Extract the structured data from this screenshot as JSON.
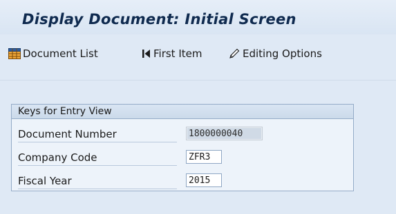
{
  "window": {
    "title": "Display Document: Initial Screen"
  },
  "toolbar": {
    "document_list": {
      "label": "Document List",
      "icon": "table-grid-icon"
    },
    "first_item": {
      "label": "First Item",
      "icon": "first-item-icon"
    },
    "editing_options": {
      "label": "Editing Options",
      "icon": "pencil-icon"
    }
  },
  "keys_group": {
    "title": "Keys for Entry View",
    "fields": [
      {
        "label": "Document Number",
        "value": "1800000040"
      },
      {
        "label": "Company Code",
        "value": "ZFR3"
      },
      {
        "label": "Fiscal Year",
        "value": "2015"
      }
    ]
  },
  "colors": {
    "background": "#dfe9f5",
    "title_text": "#0f2a4f",
    "group_border": "#94abc7",
    "focused_field": "#d0dae6"
  }
}
